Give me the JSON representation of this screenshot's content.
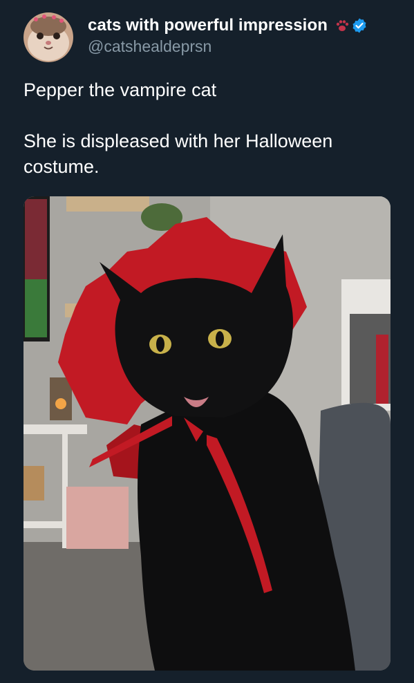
{
  "author": {
    "display_name": "cats with powerful impression",
    "handle": "@catshealdeprsn",
    "avatar_icon": "cat-avatar-icon",
    "badge_icons": [
      "paw-print-icon",
      "verified-badge-icon"
    ],
    "verified_color": "#1d9bf0"
  },
  "tweet": {
    "line1": "Pepper the vampire cat",
    "line2": "She is displeased with her Halloween costume."
  },
  "media": {
    "description_icon": "photo-icon"
  },
  "colors": {
    "background": "#15202b",
    "text": "#ffffff",
    "secondary_text": "#8899a6"
  }
}
